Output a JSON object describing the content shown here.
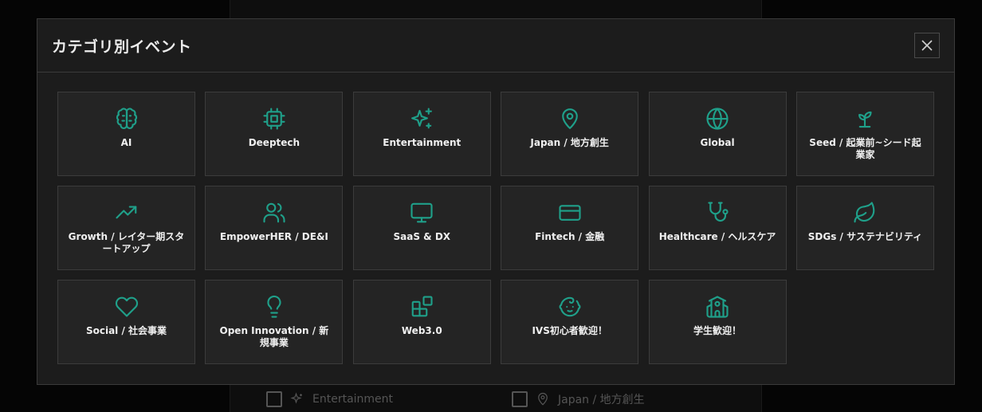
{
  "modal": {
    "title": "カテゴリ別イベント",
    "close_label": "×"
  },
  "categories": [
    {
      "label": "AI",
      "icon": "brain-icon"
    },
    {
      "label": "Deeptech",
      "icon": "chip-icon"
    },
    {
      "label": "Entertainment",
      "icon": "sparkles-icon"
    },
    {
      "label": "Japan / 地方創生",
      "icon": "map-pin-icon"
    },
    {
      "label": "Global",
      "icon": "globe-icon"
    },
    {
      "label": "Seed / 起業前~シード起業家",
      "icon": "sprout-icon"
    },
    {
      "label": "Growth / レイター期スタートアップ",
      "icon": "trending-up-icon"
    },
    {
      "label": "EmpowerHER / DE&I",
      "icon": "users-icon"
    },
    {
      "label": "SaaS & DX",
      "icon": "monitor-icon"
    },
    {
      "label": "Fintech / 金融",
      "icon": "credit-card-icon"
    },
    {
      "label": "Healthcare / ヘルスケア",
      "icon": "stethoscope-icon"
    },
    {
      "label": "SDGs / サステナビリティ",
      "icon": "leaf-icon"
    },
    {
      "label": "Social / 社会事業",
      "icon": "heart-icon"
    },
    {
      "label": "Open Innovation / 新規事業",
      "icon": "lightbulb-icon"
    },
    {
      "label": "Web3.0",
      "icon": "blocks-icon"
    },
    {
      "label": "IVS初心者歓迎！",
      "icon": "baby-face-icon"
    },
    {
      "label": "学生歓迎！",
      "icon": "school-icon"
    }
  ],
  "background_options": [
    {
      "label": "Entertainment",
      "icon": "sparkles-icon"
    },
    {
      "label": "Japan / 地方創生",
      "icon": "map-pin-icon"
    }
  ],
  "colors": {
    "accent": "#1fa08a",
    "modal_bg": "#1c1c1c",
    "card_bg": "#242424"
  }
}
